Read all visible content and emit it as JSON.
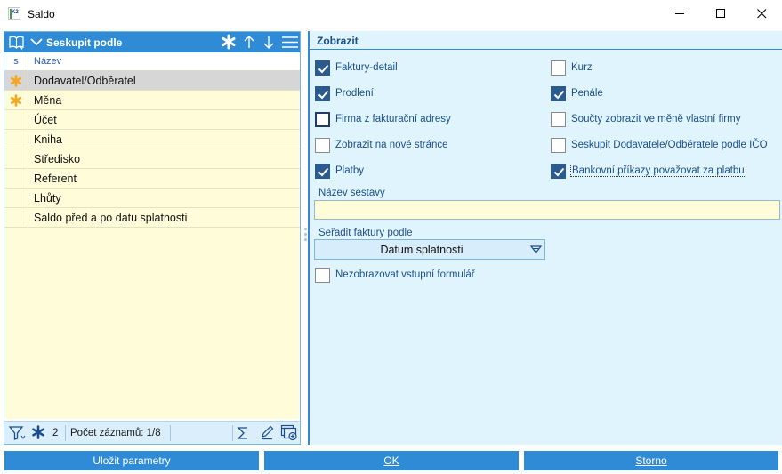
{
  "window": {
    "title": "Saldo",
    "logo_text": "K2"
  },
  "left_panel": {
    "header_title": "Seskupit podle",
    "columns": {
      "s": "s",
      "name": "Název"
    },
    "rows": [
      {
        "name": "Dodavatel/Odběratel",
        "starred": true,
        "selected": true
      },
      {
        "name": "Měna",
        "starred": true,
        "selected": false
      },
      {
        "name": "Účet",
        "starred": false,
        "selected": false
      },
      {
        "name": "Kniha",
        "starred": false,
        "selected": false
      },
      {
        "name": "Středisko",
        "starred": false,
        "selected": false
      },
      {
        "name": "Referent",
        "starred": false,
        "selected": false
      },
      {
        "name": "Lhůty",
        "starred": false,
        "selected": false
      },
      {
        "name": "Saldo před a po datu splatnosti",
        "starred": false,
        "selected": false
      }
    ],
    "footer": {
      "starred_count": "2",
      "record_count": "Počet záznamů: 1/8"
    }
  },
  "right_panel": {
    "header_title": "Zobrazit",
    "checkboxes_left": [
      {
        "label": "Faktury-detail",
        "checked": true
      },
      {
        "label": "Prodlení",
        "checked": true
      },
      {
        "label": "Firma z fakturační adresy",
        "checked": false,
        "focused": true
      },
      {
        "label": "Zobrazit na nové stránce",
        "checked": false
      },
      {
        "label": "Platby",
        "checked": true
      }
    ],
    "checkboxes_right": [
      {
        "label": "Kurz",
        "checked": false
      },
      {
        "label": "Penále",
        "checked": true
      },
      {
        "label": "Součty zobrazit ve měně vlastní firmy",
        "checked": false
      },
      {
        "label": "Seskupit Dodavatele/Odběratele podle IČO",
        "checked": false
      },
      {
        "label": "Bankovní příkazy považovat za platbu",
        "checked": true,
        "label_focus": true
      }
    ],
    "report_name_label": "Název sestavy",
    "report_name_value": "",
    "sort_label": "Seřadit faktury podle",
    "sort_value": "Datum splatnosti",
    "no_input_form": {
      "label": "Nezobrazovat vstupní formulář",
      "checked": false
    }
  },
  "buttons": {
    "save": "Uložit parametry",
    "ok": "OK",
    "cancel": "Storno"
  },
  "colors": {
    "accent": "#2f8bd6",
    "grid_bg": "#fffcd9",
    "panel_bg": "#dff4fd",
    "label_blue": "#1b4f8c",
    "star_orange": "#f5a623",
    "checkbox_checked": "#2b5a8e"
  },
  "icons": {
    "book": "book-icon",
    "chevron": "chevron-down-icon",
    "star": "asterisk-icon",
    "up": "arrow-up-icon",
    "down": "arrow-down-icon",
    "menu": "hamburger-menu-icon",
    "filter": "filter-icon",
    "sum": "sigma-icon",
    "edit": "pencil-icon",
    "add_window": "add-window-icon"
  }
}
